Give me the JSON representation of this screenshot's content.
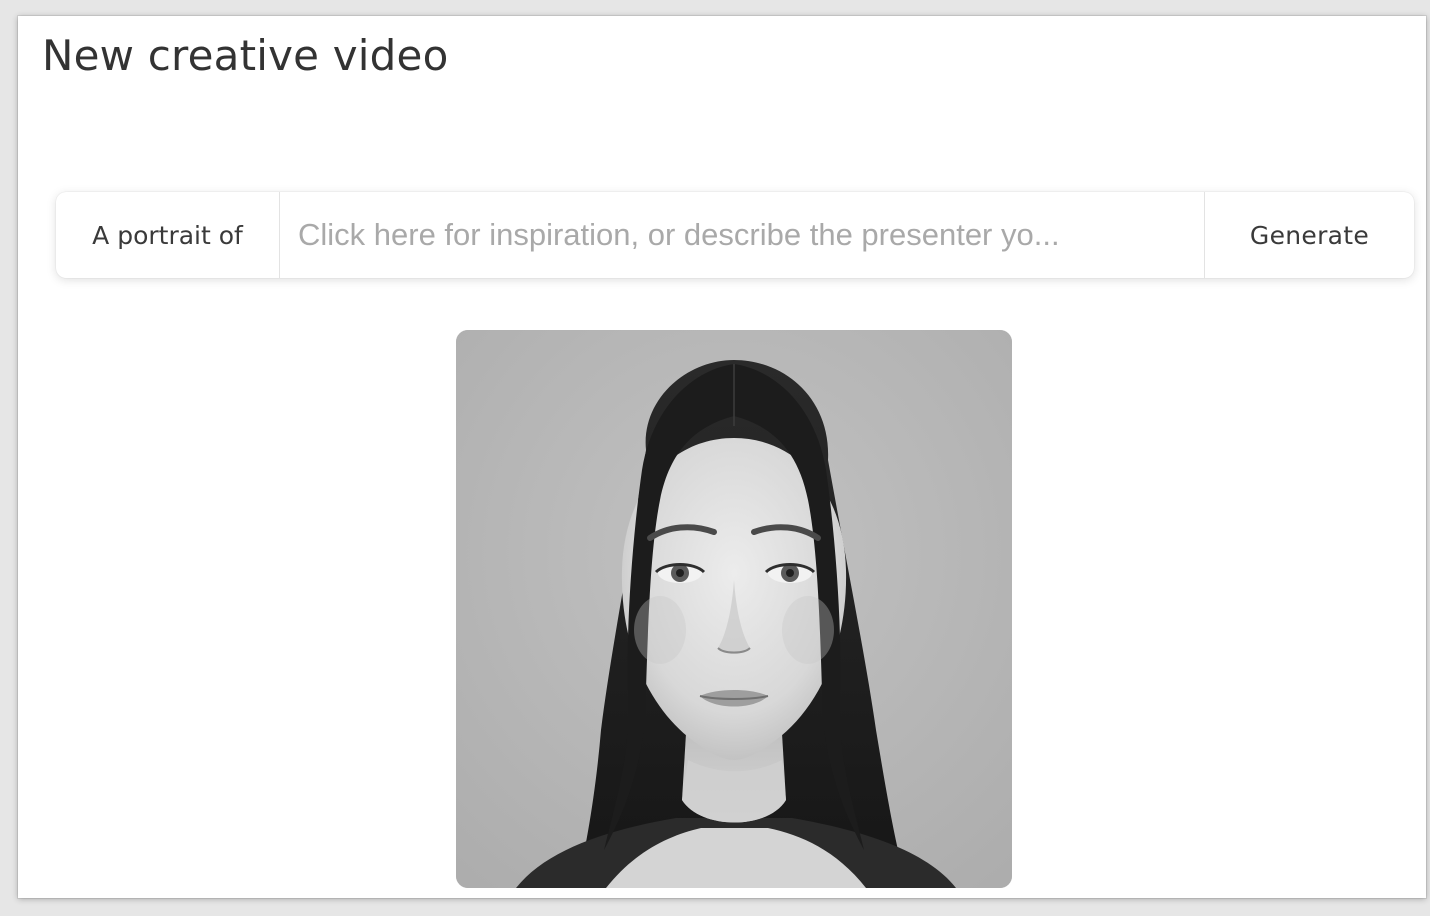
{
  "page": {
    "title": "New creative video"
  },
  "prompt_bar": {
    "prefix_label": "A portrait of",
    "input_value": "",
    "input_placeholder": "Click here for inspiration, or describe the presenter yo...",
    "generate_label": "Generate"
  },
  "portrait": {
    "description": "Generated presenter portrait",
    "background_color": "#b7b7b7"
  }
}
